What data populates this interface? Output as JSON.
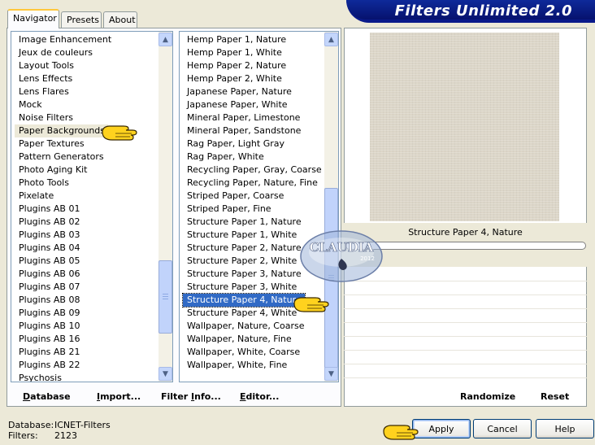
{
  "tabs": [
    {
      "label": "Navigator",
      "active": true
    },
    {
      "label": "Presets",
      "active": false
    },
    {
      "label": "About",
      "active": false
    }
  ],
  "banner": {
    "title": "Filters Unlimited 2.0"
  },
  "categories": [
    "Image Enhancement",
    "Jeux de couleurs",
    "Layout Tools",
    "Lens Effects",
    "Lens Flares",
    "Mock",
    "Noise Filters",
    "Paper Backgrounds",
    "Paper Textures",
    "Pattern Generators",
    "Photo Aging Kit",
    "Photo Tools",
    "Pixelate",
    "Plugins AB 01",
    "Plugins AB 02",
    "Plugins AB 03",
    "Plugins AB 04",
    "Plugins AB 05",
    "Plugins AB 06",
    "Plugins AB 07",
    "Plugins AB 08",
    "Plugins AB 09",
    "Plugins AB 10",
    "Plugins AB 16",
    "Plugins AB 21",
    "Plugins AB 22",
    "Psychosis"
  ],
  "selected_category": "Paper Backgrounds",
  "filters": [
    "Hemp Paper 1, Nature",
    "Hemp Paper 1, White",
    "Hemp Paper 2, Nature",
    "Hemp Paper 2, White",
    "Japanese Paper, Nature",
    "Japanese Paper, White",
    "Mineral Paper, Limestone",
    "Mineral Paper, Sandstone",
    "Rag Paper, Light Gray",
    "Rag Paper, White",
    "Recycling Paper, Gray, Coarse",
    "Recycling Paper, Nature, Fine",
    "Striped Paper, Coarse",
    "Striped Paper, Fine",
    "Structure Paper 1, Nature",
    "Structure Paper 1, White",
    "Structure Paper 2, Nature",
    "Structure Paper 2, White",
    "Structure Paper 3, Nature",
    "Structure Paper 3, White",
    "Structure Paper 4, Nature",
    "Structure Paper 4, White",
    "Wallpaper, Nature, Coarse",
    "Wallpaper, Nature, Fine",
    "Wallpaper, White, Coarse",
    "Wallpaper, White, Fine"
  ],
  "selected_filter": "Structure Paper 4, Nature",
  "preview": {
    "filter_name": "Structure Paper 4, Nature"
  },
  "watermark": {
    "text": "CLAUDIA",
    "year": "2012"
  },
  "toolbar": {
    "database_prefix": "D",
    "database_rest": "atabase",
    "import_prefix": "I",
    "import_rest": "mport...",
    "filterinfo_prefix": "Filter ",
    "filterinfo_u": "I",
    "filterinfo_rest": "nfo...",
    "editor_prefix": "E",
    "editor_rest": "ditor...",
    "randomize": "Randomize",
    "reset": "Reset"
  },
  "status": {
    "database_label": "Database:",
    "database_value": "ICNET-Filters",
    "filters_label": "Filters:",
    "filters_value": "2123"
  },
  "buttons": {
    "apply": "Apply",
    "cancel": "Cancel",
    "help": "Help"
  },
  "colors": {
    "banner": "#0a1a8a",
    "selection": "#316ac5",
    "pointer": "#ffd21e"
  }
}
